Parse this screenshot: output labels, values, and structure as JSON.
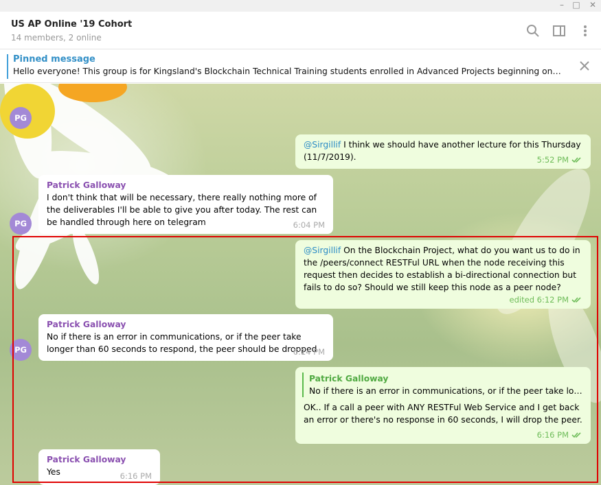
{
  "window": {
    "minimize": "–",
    "maximize": "□",
    "close": "✕"
  },
  "header": {
    "title": "US AP Online '19 Cohort",
    "subtitle": "14 members, 2 online"
  },
  "header_icons": [
    "search-icon",
    "sidebar-toggle-icon",
    "more-vertical-icon"
  ],
  "pinned": {
    "title": "Pinned message",
    "text": "Hello everyone! This group is for Kingsland's Blockchain Technical Training students enrolled in Advanced Projects beginning on Oct. ..."
  },
  "messages": [
    {
      "avatar": "PG"
    },
    {
      "mention": "@Sirgillif",
      "text": " I think we should have another lecture for this Thursday (11/7/2019).",
      "time": "5:52 PM"
    },
    {
      "sender": "Patrick Galloway",
      "avatar": "PG",
      "text": "I don't think that will be necessary, there really nothing more of the deliverables I'll be able to give you after today. The rest can be handled through here on telegram",
      "time": "6:04 PM"
    },
    {
      "mention": "@Sirgillif",
      "text": " On the Blockchain Project, what do you want us to do in the /peers/connect RESTFul URL when the node receiving this request then decides to establish a bi-directional connection but fails to do so? Should we still keep this node as a peer node?",
      "time": "edited 6:12 PM"
    },
    {
      "sender": "Patrick Galloway",
      "avatar": "PG",
      "text": "No if there is an error in communications, or if the peer take longer than 60 seconds to respond, the peer should be dropped",
      "time": "6:14 PM"
    },
    {
      "reply_name": "Patrick Galloway",
      "reply_text": "No if there is an error in communications, or if the peer take long...",
      "text": "OK.. If a call a peer with ANY RESTFul Web Service and I get back an error or there's no response in 60 seconds, I will drop the peer.",
      "time": "6:16 PM"
    },
    {
      "sender": "Patrick Galloway",
      "text": "Yes",
      "time": "6:16 PM"
    }
  ],
  "colors": {
    "accent": "#419fd9",
    "avatar": "#a389d6",
    "sender": "#8a50b0",
    "outgoing_bubble": "#effdde",
    "highlight": "#e00000"
  }
}
